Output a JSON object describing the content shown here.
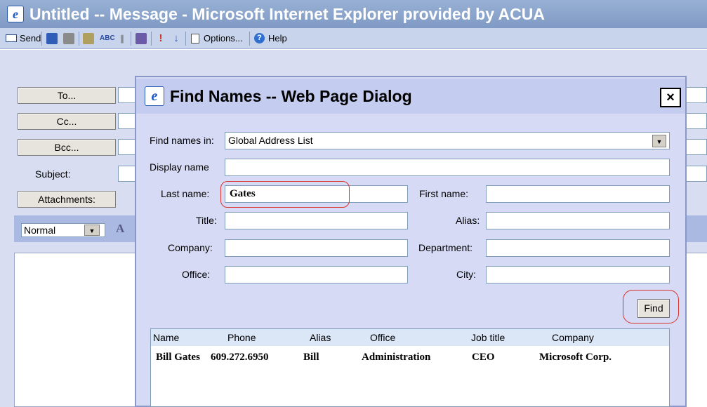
{
  "window": {
    "title": "Untitled -- Message - Microsoft Internet Explorer provided by ACUA",
    "icon_glyph": "e"
  },
  "toolbar": {
    "send_label": "Send",
    "options_label": "Options...",
    "help_label": "Help"
  },
  "compose": {
    "to_label": "To...",
    "cc_label": "Cc...",
    "bcc_label": "Bcc...",
    "subject_label": "Subject:",
    "attachments_label": "Attachments:",
    "format_value": "Normal",
    "font_glyph": "A"
  },
  "dialog": {
    "title": "Find Names -- Web Page Dialog",
    "close_glyph": "×",
    "find_in_label": "Find names in:",
    "find_in_value": "Global Address List",
    "display_name_label": "Display name",
    "display_name_value": "",
    "last_name_label": "Last name:",
    "last_name_value": "Gates",
    "first_name_label": "First name:",
    "first_name_value": "",
    "title_label": "Title:",
    "title_value": "",
    "alias_label": "Alias:",
    "alias_value": "",
    "company_label": "Company:",
    "company_value": "",
    "department_label": "Department:",
    "department_value": "",
    "office_label": "Office:",
    "office_value": "",
    "city_label": "City:",
    "city_value": "",
    "find_button": "Find"
  },
  "results": {
    "columns": [
      "Name",
      "Phone",
      "Alias",
      "Office",
      "Job title",
      "Company"
    ],
    "rows": [
      [
        "Bill Gates",
        "609.272.6950",
        "Bill",
        "Administration",
        "CEO",
        "Microsoft Corp."
      ]
    ]
  },
  "colors": {
    "dialog_bg": "#d6daf5",
    "highlight": "#d9342b",
    "title_bar": "#8aa4cc"
  }
}
